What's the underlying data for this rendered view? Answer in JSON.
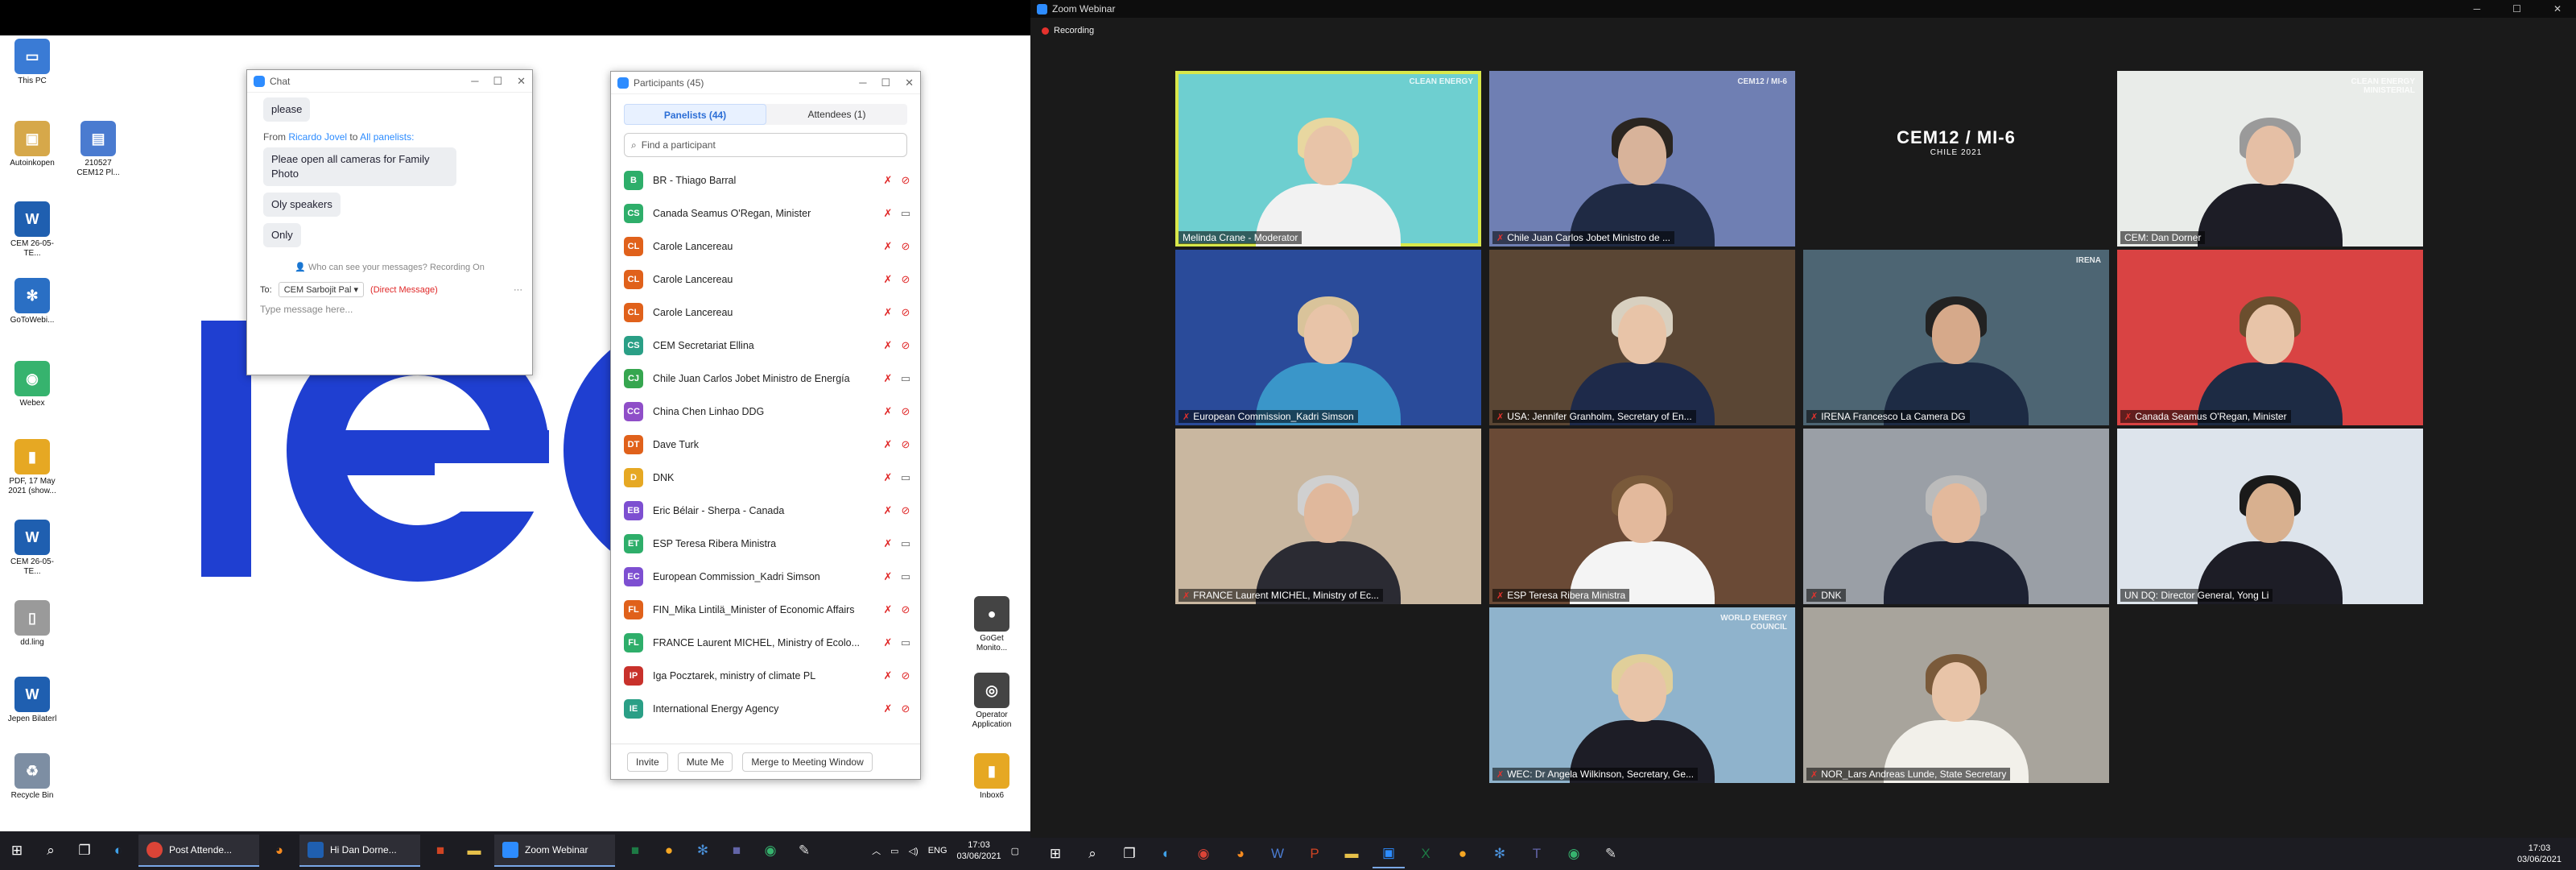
{
  "desktop": {
    "icons": [
      {
        "label": "This PC",
        "color": "#3a7bd5",
        "glyph": "▭"
      },
      {
        "label": "Autoinkopen",
        "color": "#d6a84a",
        "glyph": "▣"
      },
      {
        "label": "210527 CEM12 Pl...",
        "color": "#4a7bd0",
        "glyph": "▤"
      },
      {
        "label": "CEM 26-05-TE...",
        "color": "#1f5fb0",
        "glyph": "W"
      },
      {
        "label": "GoToWebi...",
        "color": "#2a6fc4",
        "glyph": "✻"
      },
      {
        "label": "Webex",
        "color": "#36b36e",
        "glyph": "◉"
      },
      {
        "label": "PDF, 17 May 2021 (show...",
        "color": "#e6a823",
        "glyph": "▮"
      },
      {
        "label": "CEM 26-05-TE...",
        "color": "#1f5fb0",
        "glyph": "W"
      },
      {
        "label": "dd.ling",
        "color": "#9a9a9a",
        "glyph": "▯"
      },
      {
        "label": "Jepen Bilaterl",
        "color": "#1f5fb0",
        "glyph": "W"
      },
      {
        "label": "Recycle Bin",
        "color": "#7d8ea3",
        "glyph": "♻"
      },
      {
        "label": "GoGet Monito...",
        "color": "#444",
        "glyph": "●"
      },
      {
        "label": "Operator Application",
        "color": "#444",
        "glyph": "◎"
      },
      {
        "label": "Inbox6",
        "color": "#e6a823",
        "glyph": "▮"
      }
    ]
  },
  "chat": {
    "title": "Chat",
    "messages": [
      {
        "type": "bubble",
        "text": "please"
      },
      {
        "type": "from",
        "from_prefix": "From",
        "from_name": "Ricardo Jovel",
        "to_word": "to",
        "to_name": "All panelists:"
      },
      {
        "type": "bubble",
        "text": "Pleae open all cameras for Family Photo"
      },
      {
        "type": "bubble",
        "text": "Oly speakers"
      },
      {
        "type": "bubble",
        "text": "Only"
      }
    ],
    "notice": "Who can see your messages? Recording On",
    "to_label": "To:",
    "to_value": "CEM Sarbojit Pal",
    "dm_label": "(Direct Message)",
    "input_placeholder": "Type message here..."
  },
  "participants": {
    "title": "Participants (45)",
    "tabs": [
      {
        "label": "Panelists (44)",
        "active": true
      },
      {
        "label": "Attendees (1)",
        "active": false
      }
    ],
    "search_placeholder": "Find a participant",
    "list": [
      {
        "initials": "B",
        "color": "#2eae6a",
        "name": "BR - Thiago Barral",
        "mic": "off",
        "cam": "off"
      },
      {
        "initials": "CS",
        "color": "#2eae6a",
        "name": "Canada Seamus O'Regan, Minister",
        "mic": "off",
        "cam": "on"
      },
      {
        "initials": "CL",
        "color": "#e0611b",
        "name": "Carole Lancereau",
        "mic": "off",
        "cam": "off"
      },
      {
        "initials": "CL",
        "color": "#e0611b",
        "name": "Carole Lancereau",
        "mic": "off",
        "cam": "off"
      },
      {
        "initials": "CL",
        "color": "#e0611b",
        "name": "Carole Lancereau",
        "mic": "off",
        "cam": "off"
      },
      {
        "initials": "CS",
        "color": "#2a9f86",
        "name": "CEM Secretariat Ellina",
        "mic": "off",
        "cam": "off"
      },
      {
        "initials": "CJ",
        "color": "#36a64f",
        "name": "Chile Juan Carlos Jobet Ministro de Energía",
        "mic": "off",
        "cam": "on"
      },
      {
        "initials": "CC",
        "color": "#8f4ec8",
        "name": "China Chen Linhao DDG",
        "mic": "off",
        "cam": "off"
      },
      {
        "initials": "DT",
        "color": "#e0611b",
        "name": "Dave Turk",
        "mic": "off",
        "cam": "off"
      },
      {
        "initials": "D",
        "color": "#e6a823",
        "name": "DNK",
        "mic": "off",
        "cam": "on"
      },
      {
        "initials": "EB",
        "color": "#7d4fd1",
        "name": "Eric Bélair - Sherpa - Canada",
        "mic": "off",
        "cam": "off"
      },
      {
        "initials": "ET",
        "color": "#2eae6a",
        "name": "ESP Teresa Ribera Ministra",
        "mic": "off",
        "cam": "on"
      },
      {
        "initials": "EC",
        "color": "#7d4fd1",
        "name": "European Commission_Kadri Simson",
        "mic": "off",
        "cam": "on"
      },
      {
        "initials": "FL",
        "color": "#e0611b",
        "name": "FIN_Mika Lintilä_Minister of Economic Affairs",
        "mic": "off",
        "cam": "off"
      },
      {
        "initials": "FL",
        "color": "#2eae6a",
        "name": "FRANCE Laurent MICHEL, Ministry of Ecolo...",
        "mic": "off",
        "cam": "on"
      },
      {
        "initials": "IP",
        "color": "#c8312b",
        "name": "Iga Pocztarek, ministry of climate PL",
        "mic": "off",
        "cam": "off"
      },
      {
        "initials": "IE",
        "color": "#2a9f86",
        "name": "International Energy Agency",
        "mic": "off",
        "cam": "off"
      }
    ],
    "footer": {
      "invite": "Invite",
      "mute": "Mute Me",
      "merge": "Merge to Meeting Window"
    }
  },
  "left_taskbar": {
    "apps": [
      {
        "label": "Post Attende...",
        "color": "#db4437"
      },
      {
        "label": "Hi Dan Dorne...",
        "color": "#1f5fb0"
      },
      {
        "label": "Zoom Webinar",
        "color": "#2d8cff"
      }
    ],
    "lang": "ENG",
    "time": "17:03",
    "date": "03/06/2021"
  },
  "zoom": {
    "title": "Zoom Webinar",
    "recording": "Recording",
    "tiles": [
      {
        "name": "Melinda Crane - Moderator",
        "muted": false,
        "bg": "#6ecfd0",
        "skin": "#e8c4a8",
        "hair": "#e8d7a0",
        "body": "#f2f2f2",
        "active": true,
        "logo": "CLEAN ENERGY"
      },
      {
        "name": "Chile Juan Carlos Jobet Ministro de ...",
        "muted": true,
        "bg": "#6f7fb3",
        "skin": "#d8b39a",
        "hair": "#2a2520",
        "body": "#1f2a44",
        "logo": "CEM12 / MI-6"
      },
      {
        "name": "",
        "muted": false,
        "bg": "#1a1a1a",
        "cem": true,
        "cem_text": "CEM12 / MI-6",
        "cem_sub": "CHILE 2021"
      },
      {
        "name": "CEM: Dan Dorner",
        "muted": false,
        "bg": "#e9ece9",
        "skin": "#e5bfa5",
        "hair": "#9a9a9a",
        "body": "#1d1d26",
        "logo": "CLEAN ENERGY MINISTERIAL"
      },
      {
        "name": "European Commission_Kadri Simson",
        "muted": true,
        "bg": "#2a4b9a",
        "skin": "#e8c4a8",
        "hair": "#d9c39a",
        "body": "#3a96c9"
      },
      {
        "name": "USA: Jennifer Granholm, Secretary of En...",
        "muted": true,
        "bg": "#5a4634",
        "skin": "#e8c4a8",
        "hair": "#d8d0c0",
        "body": "#1e2a4a"
      },
      {
        "name": "IRENA Francesco La Camera DG",
        "muted": true,
        "bg": "#4d6573",
        "skin": "#d6a98a",
        "hair": "#222",
        "body": "#1d2b44",
        "logo": "IRENA"
      },
      {
        "name": "Canada Seamus O'Regan, Minister",
        "muted": true,
        "bg": "#d94343",
        "skin": "#e8c4a8",
        "hair": "#6b4e2e",
        "body": "#1d2b44"
      },
      {
        "name": "FRANCE Laurent MICHEL, Ministry of Ec...",
        "muted": true,
        "bg": "#c9b7a0",
        "skin": "#e0b89c",
        "hair": "#d0d0d0",
        "body": "#2b2b33"
      },
      {
        "name": "ESP Teresa Ribera Ministra",
        "muted": true,
        "bg": "#6a4a36",
        "skin": "#e3b99c",
        "hair": "#7a5a3a",
        "body": "#f4f4f4"
      },
      {
        "name": "DNK",
        "muted": true,
        "bg": "#9a9fa6",
        "skin": "#e3b99c",
        "hair": "#bbb",
        "body": "#1d2233"
      },
      {
        "name": "UN DQ: Director General, Yong Li",
        "muted": false,
        "bg": "#dde4ec",
        "skin": "#d8b08f",
        "hair": "#1a1a1a",
        "body": "#1d1d26"
      },
      {
        "name": "WEC: Dr Angela Wilkinson, Secretary, Ge...",
        "muted": true,
        "bg": "#8fb3cc",
        "skin": "#e8c4a8",
        "hair": "#e0cf9a",
        "body": "#1d1d26",
        "logo": "WORLD ENERGY COUNCIL"
      },
      {
        "name": "NOR_Lars Andreas Lunde, State Secretary",
        "muted": true,
        "bg": "#a8a49c",
        "skin": "#e8c4a8",
        "hair": "#7a5a3a",
        "body": "#f2f0ea"
      }
    ]
  },
  "right_taskbar": {
    "time": "17:03",
    "date": "03/06/2021"
  }
}
